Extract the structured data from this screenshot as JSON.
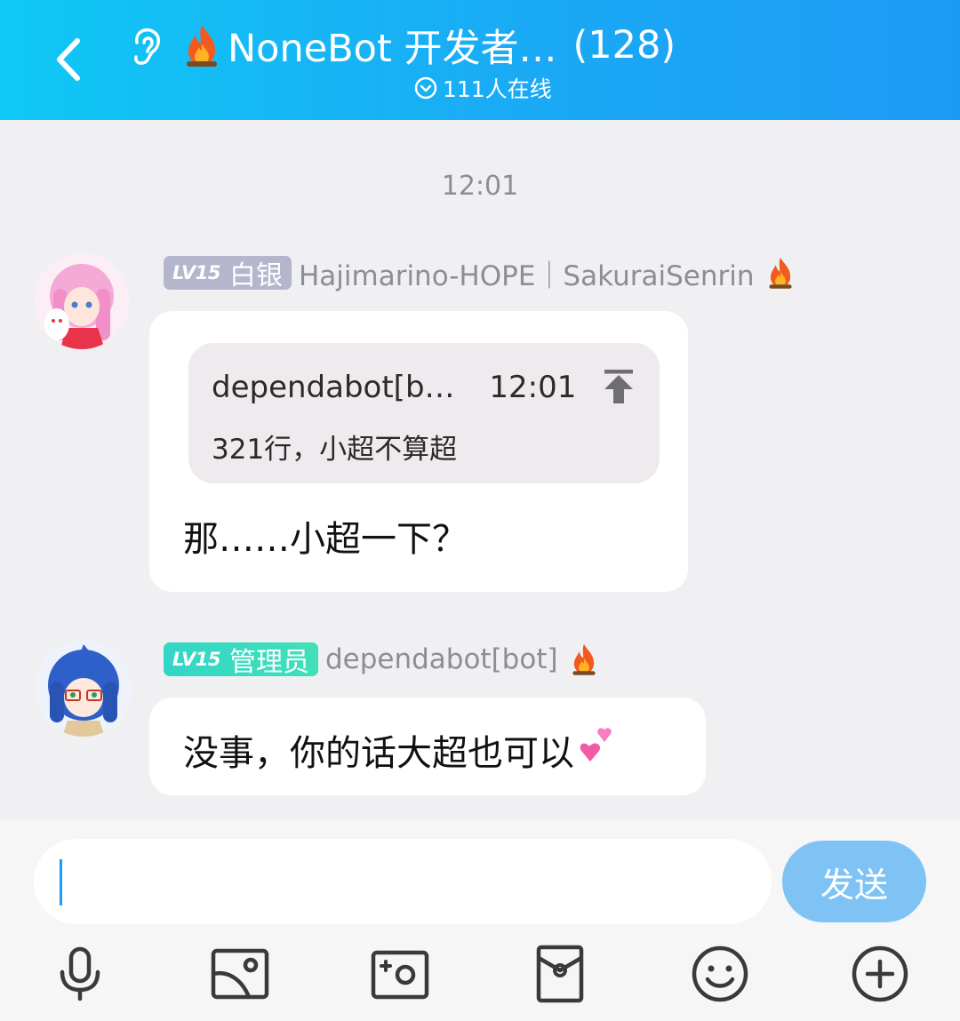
{
  "header": {
    "title": "NoneBot 开发者…",
    "member_count": "(128)",
    "online_text": "111人在线"
  },
  "chat": {
    "timestamp": "12:01",
    "messages": [
      {
        "badge_level": "LV15",
        "badge_role": "白银",
        "sender": "Hajimarino-HOPE｜SakuraiSenrin",
        "quote": {
          "author": "dependabot[b…",
          "time": "12:01",
          "text": "321行，小超不算超"
        },
        "text": "那……小超一下？"
      },
      {
        "badge_level": "LV15",
        "badge_role": "管理员",
        "sender": "dependabot[bot]",
        "text": "没事，你的话大超也可以"
      }
    ]
  },
  "composer": {
    "input_value": "",
    "send_label": "发送",
    "tools": [
      "microphone-icon",
      "image-icon",
      "camera-icon",
      "red-packet-icon",
      "emoji-icon",
      "plus-icon"
    ]
  },
  "colors": {
    "header_start": "#10c8f6",
    "header_end": "#1d9bf4",
    "send_button": "#7fc3f5",
    "badge_silver": "#b3b6cc",
    "badge_admin": "#33d6c8"
  }
}
